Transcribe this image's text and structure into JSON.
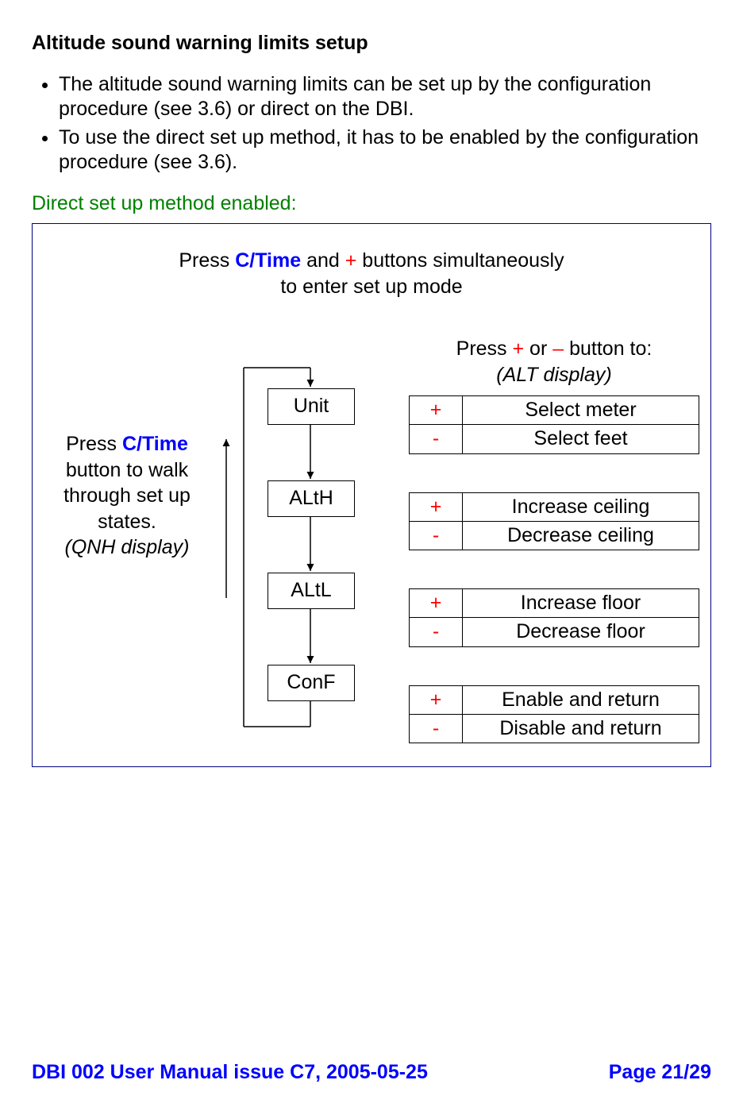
{
  "heading": "Altitude sound warning limits setup",
  "bullets": [
    "The altitude sound warning limits can be set up by the configuration procedure (see 3.6) or direct on the DBI.",
    "To use the direct set up method, it has to be enabled by the configuration procedure (see 3.6)."
  ],
  "subhead": "Direct set up method enabled:",
  "intro": {
    "p1a": "Press  ",
    "p1b": "C/Time",
    "p1c": "  and ",
    "p1d": "+",
    "p1e": " buttons simultaneously",
    "p2": "to enter set up mode"
  },
  "left": {
    "l1a": "Press  ",
    "l1b": "C/Time",
    "l2": "button to walk",
    "l3": "through set up",
    "l4": "states.",
    "l5": "(QNH display)"
  },
  "states": [
    "Unit",
    "ALtH",
    "ALtL",
    "ConF"
  ],
  "right_header": {
    "r1a": "Press ",
    "r1b": "+",
    "r1c": " or ",
    "r1d": "–",
    "r1e": " button to:",
    "r2": "(ALT display)"
  },
  "tables": [
    {
      "plus": "Select meter",
      "minus": "Select  feet"
    },
    {
      "plus": "Increase ceiling",
      "minus": "Decrease ceiling"
    },
    {
      "plus": "Increase floor",
      "minus": "Decrease floor"
    },
    {
      "plus": "Enable and return",
      "minus": "Disable and return"
    }
  ],
  "sym": {
    "plus": "+",
    "minus": "-"
  },
  "footer": {
    "left": "DBI 002 User Manual issue C7, 2005-05-25",
    "right": "Page 21/29"
  }
}
